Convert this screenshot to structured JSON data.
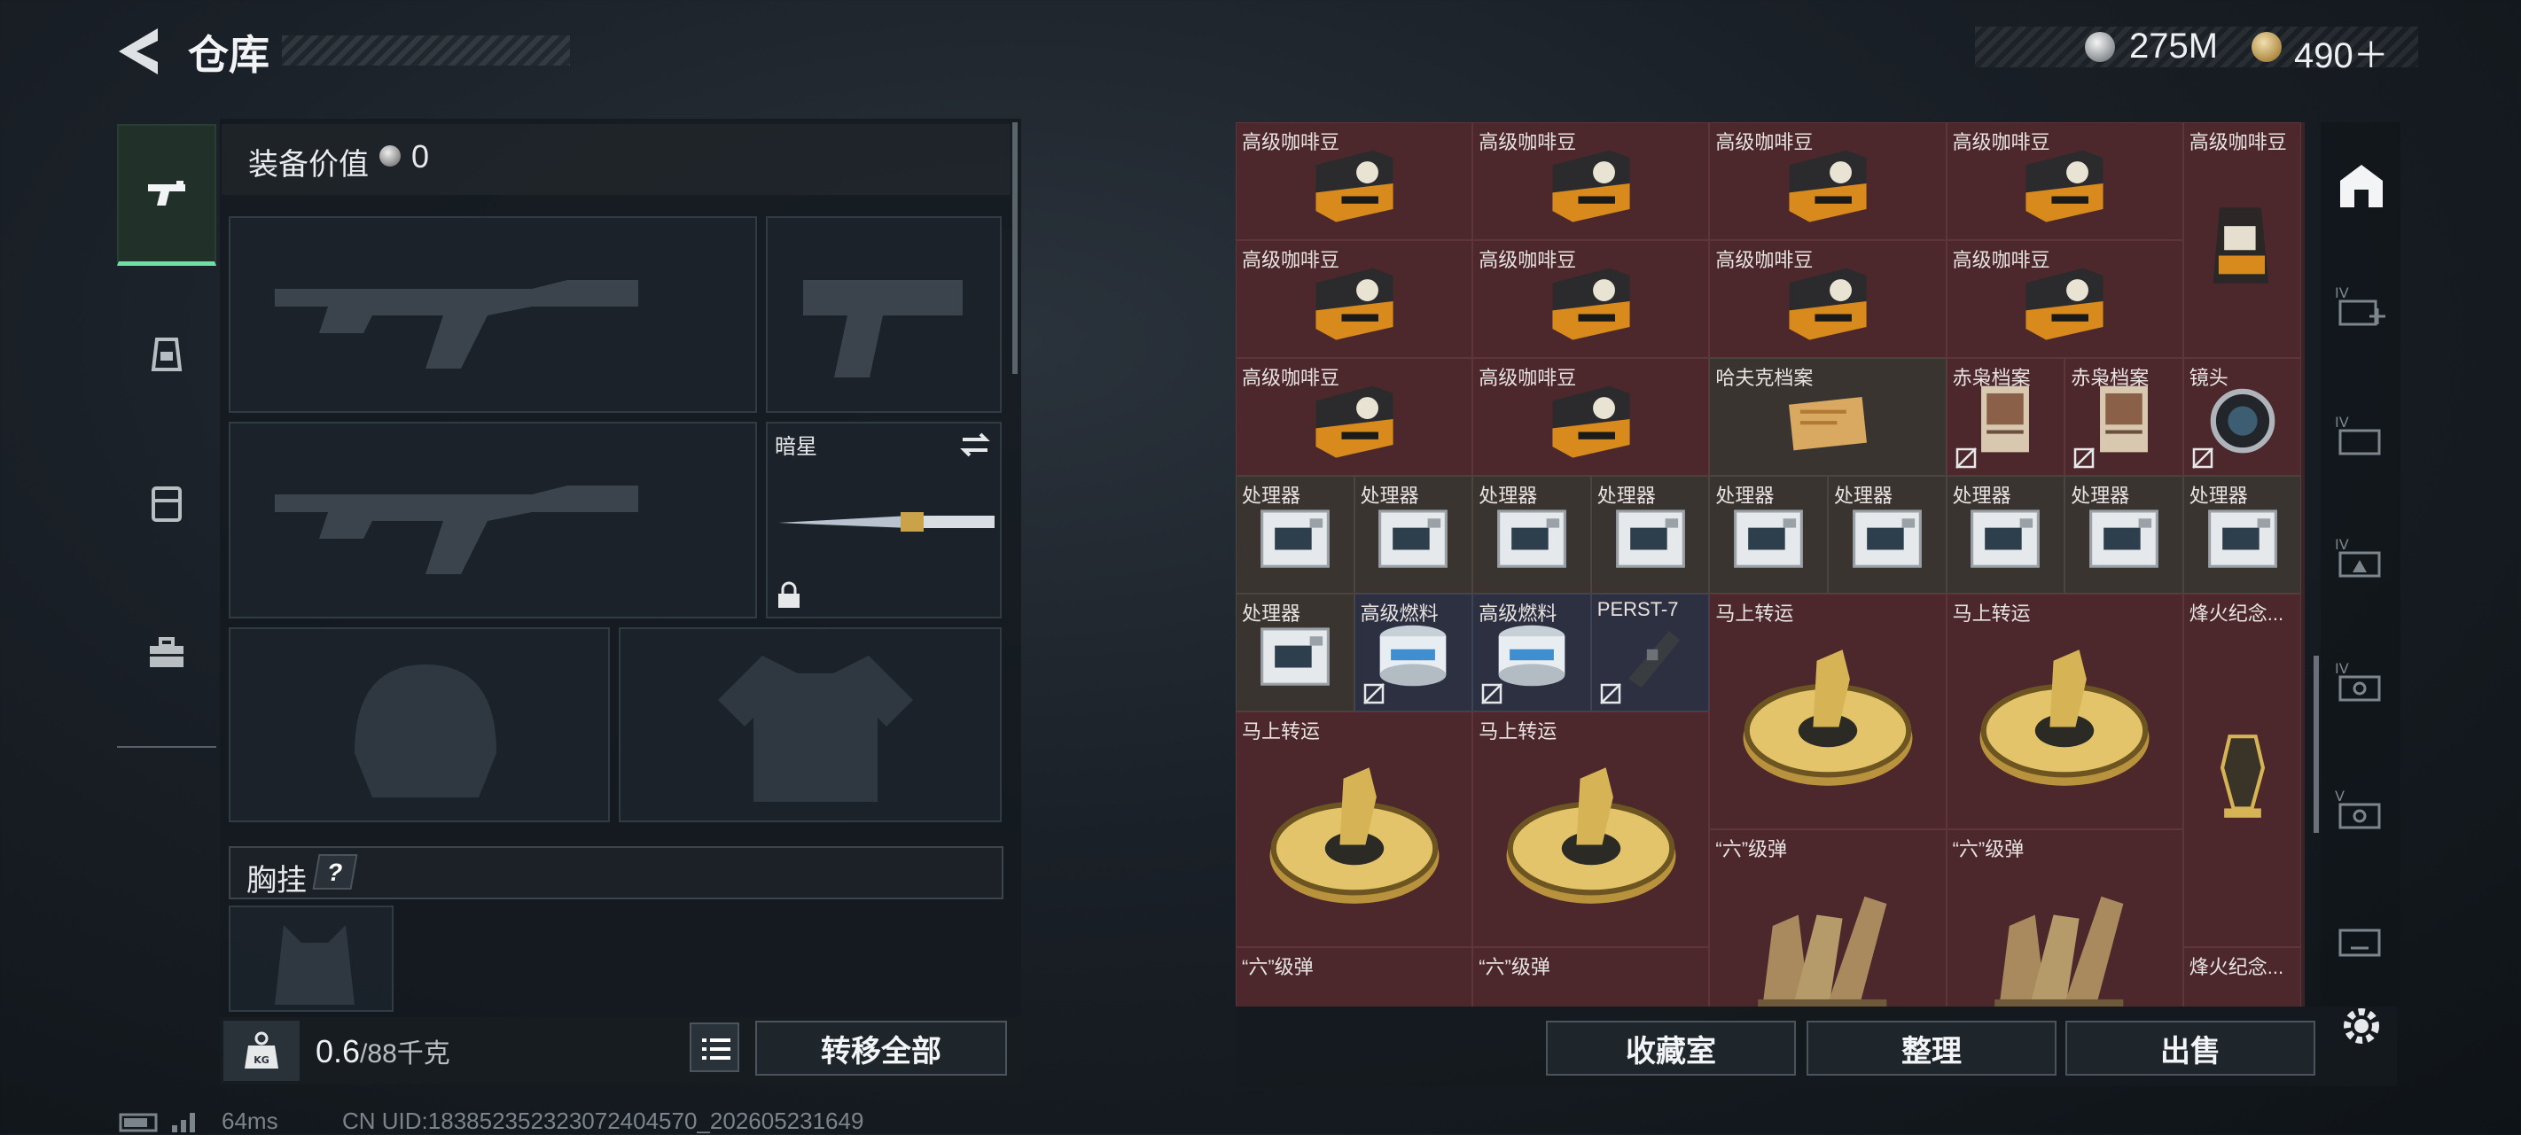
{
  "header": {
    "title": "仓库",
    "currency_silver": "275M",
    "currency_gold": "490＋"
  },
  "equipment": {
    "value_label": "装备价值",
    "value": "0",
    "knife_slot_label": "暗星",
    "chest_rig_label": "胸挂",
    "help": "?"
  },
  "weight": {
    "current": "0.6",
    "max_unit": "/88千克"
  },
  "buttons": {
    "transfer_all": "转移全部",
    "collection": "收藏室",
    "organize": "整理",
    "sell": "出售"
  },
  "storage_items": [
    {
      "name": "高级咖啡豆",
      "type": "coffee"
    },
    {
      "name": "高级咖啡豆",
      "type": "coffee"
    },
    {
      "name": "高级咖啡豆",
      "type": "coffee"
    },
    {
      "name": "高级咖啡豆",
      "type": "coffee"
    },
    {
      "name": "高级咖啡豆",
      "type": "coffee-bag"
    },
    {
      "name": "高级咖啡豆",
      "type": "coffee"
    },
    {
      "name": "高级咖啡豆",
      "type": "coffee"
    },
    {
      "name": "高级咖啡豆",
      "type": "coffee"
    },
    {
      "name": "高级咖啡豆",
      "type": "coffee"
    },
    {
      "name": "高级咖啡豆",
      "type": "coffee"
    },
    {
      "name": "高级咖啡豆",
      "type": "coffee"
    },
    {
      "name": "哈夫克档案",
      "type": "file"
    },
    {
      "name": "赤枭档案",
      "type": "photo"
    },
    {
      "name": "赤枭档案",
      "type": "photo"
    },
    {
      "name": "镜头",
      "type": "lens"
    },
    {
      "name": "处理器",
      "type": "cpu"
    },
    {
      "name": "处理器",
      "type": "cpu"
    },
    {
      "name": "处理器",
      "type": "cpu"
    },
    {
      "name": "处理器",
      "type": "cpu"
    },
    {
      "name": "处理器",
      "type": "cpu"
    },
    {
      "name": "处理器",
      "type": "cpu"
    },
    {
      "name": "处理器",
      "type": "cpu"
    },
    {
      "name": "处理器",
      "type": "cpu"
    },
    {
      "name": "处理器",
      "type": "cpu"
    },
    {
      "name": "处理器",
      "type": "cpu"
    },
    {
      "name": "高级燃料",
      "type": "fuel"
    },
    {
      "name": "高级燃料",
      "type": "fuel"
    },
    {
      "name": "PERST-7",
      "type": "chip"
    },
    {
      "name": "马上转运",
      "type": "wheel"
    },
    {
      "name": "马上转运",
      "type": "wheel"
    },
    {
      "name": "烽火纪念...",
      "type": "trophy"
    },
    {
      "name": "马上转运",
      "type": "wheel"
    },
    {
      "name": "马上转运",
      "type": "wheel"
    },
    {
      "name": "“六”级弹",
      "type": "ammo"
    },
    {
      "name": "“六”级弹",
      "type": "ammo"
    },
    {
      "name": "“六”级弹",
      "type": "ammo"
    },
    {
      "name": "“六”级弹",
      "type": "ammo"
    },
    {
      "name": "烽火纪念...",
      "type": "trophy"
    }
  ],
  "status": {
    "ping": "64ms",
    "uid": "CN UID:18385235232307240457​0_202605231649"
  },
  "colors": {
    "accent_green": "#6ee0a6",
    "cell_red": "#4c282d",
    "cell_blue": "#2c3041"
  }
}
